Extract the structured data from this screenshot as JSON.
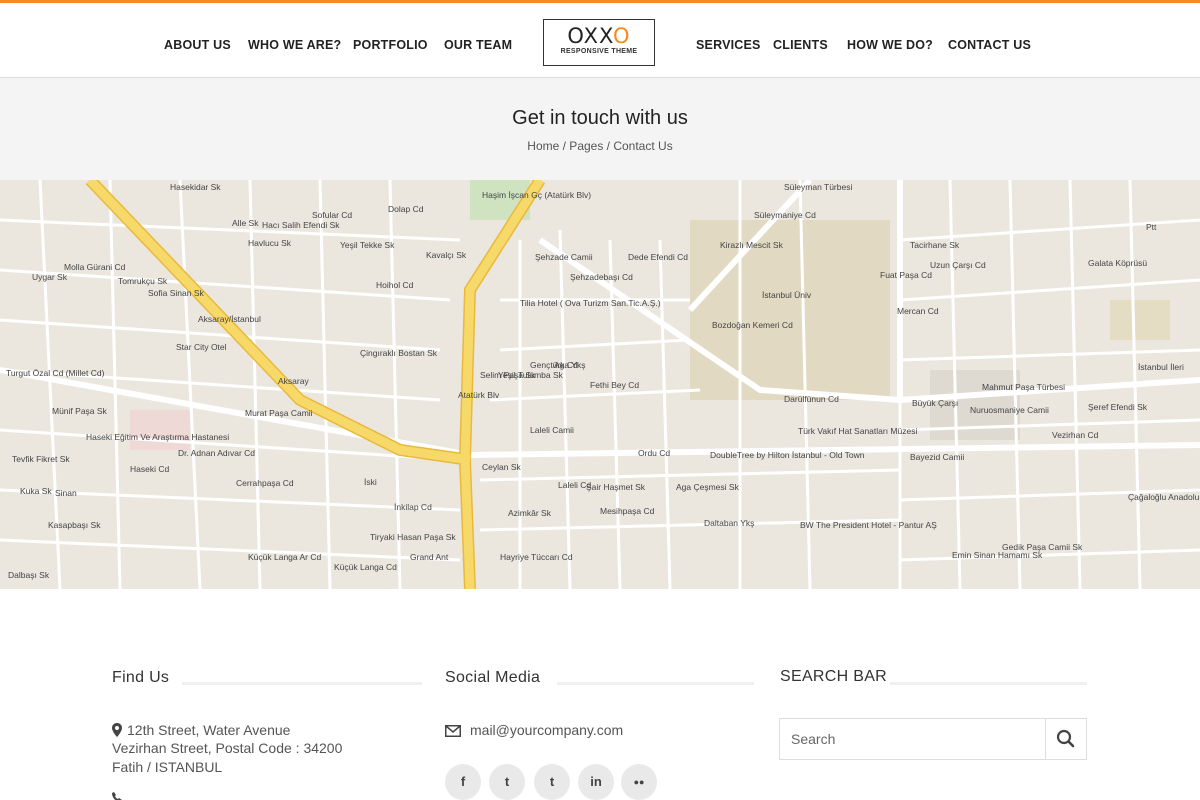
{
  "nav": {
    "left": [
      "ABOUT US",
      "WHO WE ARE?",
      "PORTFOLIO",
      "OUR TEAM"
    ],
    "right": [
      "SERVICES",
      "CLIENTS",
      "HOW WE DO?",
      "CONTACT US"
    ]
  },
  "logo": {
    "part1": "OXX",
    "part2": "O",
    "tagline": "RESPONSIVE THEME"
  },
  "page": {
    "title": "Get in touch with us",
    "breadcrumb": "Home / Pages / Contact Us"
  },
  "map": {
    "labels": [
      "Hasekidar Sk",
      "Alle Sk",
      "Havlucu Sk",
      "Hacı Salih Efendi Sk",
      "Sofular Cd",
      "Dolap Cd",
      "Yeşil Tekke Sk",
      "Kavalçı Sk",
      "Hoihol Cd",
      "Haşim İşcan Gç (Atatürk Blv)",
      "Şehzade Camii",
      "Şehzadebaşı Cd",
      "Dede Efendi Cd",
      "Tilia Hotel ( Ova Turizm San.Tic.A.Ş.)",
      "Kirazlı Mescit Sk",
      "Süleymaniye Cd",
      "Süleyman Türbesi",
      "Fuat Paşa Cd",
      "Tacirhane Sk",
      "Uzun Çarşı Cd",
      "Galata Köprüsü",
      "Ptt",
      "Mercan Cd",
      "Bozdoğan Kemeri Cd",
      "İstanbul Üniv",
      "Darülfünun Cd",
      "Mahmut Paşa Türbesi",
      "Nuruosmaniye Camii",
      "Büyük Çarşı",
      "Şeref Efendi Sk",
      "İstanbul İleri",
      "Molla Gürani Cd",
      "Uygar Sk",
      "Tomrukçu Sk",
      "Sofia Sinan Sk",
      "Aksaray/İstanbul",
      "Star City Otel",
      "Çingıraklı Bostan Sk",
      "Aksaray",
      "Murat Paşa Camii",
      "Atatürk Blv",
      "Gençtürk Cd",
      "Aga Ykş",
      "Fethi Bey Cd",
      "Laleli Camii",
      "Ordu Cd",
      "DoubleTree by Hilton İstanbul - Old Town",
      "Türk Vakıf Hat Sanatları Müzesi",
      "Bayezid Camii",
      "Vezirhan Cd",
      "Çağaloğlu Anadolu",
      "Turgut Özal Cd (Millet Cd)",
      "Münif Paşa Sk",
      "Haseki Eğitim Ve Araştırma Hastanesi",
      "Dr. Adnan Adıvar Cd",
      "Haseki Cd",
      "Cerrahpaşa Cd",
      "İski",
      "Ceylan Sk",
      "Şair Haşmet Sk",
      "Aga Çeşmesi Sk",
      "İnkilap Cd",
      "Mesihpaşa Cd",
      "Azimkâr Sk",
      "Laleli Cd",
      "Tiryaki Hasan Paşa Sk",
      "Grand Ant",
      "Hayriye Tüccarı Cd",
      "Küçük Langa Ar Cd",
      "Küçük Langa Cd",
      "Daltaban Ykş",
      "BW The President Hotel - Pantur AŞ",
      "Gedik Paşa Camii Sk",
      "Emin Sinan Hamamı Sk",
      "Kuka Sk",
      "Sinan",
      "Kasapbaşı Sk",
      "Tevfik Fikret Sk",
      "Dalbaşı Sk",
      "Selim Paşa Sk",
      "Yeşil Tulumba Sk"
    ]
  },
  "find_us": {
    "title": "Find Us",
    "address_line1": "12th Street, Water Avenue",
    "address_line2": "Vezirhan Street, Postal Code : 34200",
    "address_line3": "Fatih / ISTANBUL"
  },
  "social": {
    "title": "Social Media",
    "email": "mail@yourcompany.com",
    "icons": [
      "facebook-icon",
      "twitter-icon",
      "tumblr-icon",
      "linkedin-icon",
      "flickr-icon"
    ],
    "glyphs": [
      "f",
      "t",
      "t",
      "in",
      "●●"
    ]
  },
  "search": {
    "title": "SEARCH BAR",
    "placeholder": "Search"
  },
  "colors": {
    "accent": "#f7891f",
    "map_road_major": "#f5d55f",
    "map_background": "#ebe7df"
  }
}
